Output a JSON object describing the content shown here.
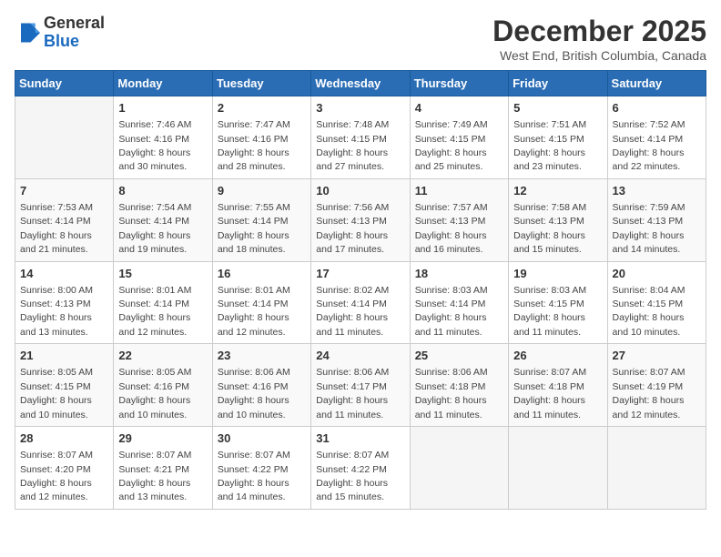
{
  "header": {
    "logo_general": "General",
    "logo_blue": "Blue",
    "month_title": "December 2025",
    "location": "West End, British Columbia, Canada"
  },
  "days_of_week": [
    "Sunday",
    "Monday",
    "Tuesday",
    "Wednesday",
    "Thursday",
    "Friday",
    "Saturday"
  ],
  "weeks": [
    [
      {
        "day": "",
        "info": ""
      },
      {
        "day": "1",
        "info": "Sunrise: 7:46 AM\nSunset: 4:16 PM\nDaylight: 8 hours\nand 30 minutes."
      },
      {
        "day": "2",
        "info": "Sunrise: 7:47 AM\nSunset: 4:16 PM\nDaylight: 8 hours\nand 28 minutes."
      },
      {
        "day": "3",
        "info": "Sunrise: 7:48 AM\nSunset: 4:15 PM\nDaylight: 8 hours\nand 27 minutes."
      },
      {
        "day": "4",
        "info": "Sunrise: 7:49 AM\nSunset: 4:15 PM\nDaylight: 8 hours\nand 25 minutes."
      },
      {
        "day": "5",
        "info": "Sunrise: 7:51 AM\nSunset: 4:15 PM\nDaylight: 8 hours\nand 23 minutes."
      },
      {
        "day": "6",
        "info": "Sunrise: 7:52 AM\nSunset: 4:14 PM\nDaylight: 8 hours\nand 22 minutes."
      }
    ],
    [
      {
        "day": "7",
        "info": "Sunrise: 7:53 AM\nSunset: 4:14 PM\nDaylight: 8 hours\nand 21 minutes."
      },
      {
        "day": "8",
        "info": "Sunrise: 7:54 AM\nSunset: 4:14 PM\nDaylight: 8 hours\nand 19 minutes."
      },
      {
        "day": "9",
        "info": "Sunrise: 7:55 AM\nSunset: 4:14 PM\nDaylight: 8 hours\nand 18 minutes."
      },
      {
        "day": "10",
        "info": "Sunrise: 7:56 AM\nSunset: 4:13 PM\nDaylight: 8 hours\nand 17 minutes."
      },
      {
        "day": "11",
        "info": "Sunrise: 7:57 AM\nSunset: 4:13 PM\nDaylight: 8 hours\nand 16 minutes."
      },
      {
        "day": "12",
        "info": "Sunrise: 7:58 AM\nSunset: 4:13 PM\nDaylight: 8 hours\nand 15 minutes."
      },
      {
        "day": "13",
        "info": "Sunrise: 7:59 AM\nSunset: 4:13 PM\nDaylight: 8 hours\nand 14 minutes."
      }
    ],
    [
      {
        "day": "14",
        "info": "Sunrise: 8:00 AM\nSunset: 4:13 PM\nDaylight: 8 hours\nand 13 minutes."
      },
      {
        "day": "15",
        "info": "Sunrise: 8:01 AM\nSunset: 4:14 PM\nDaylight: 8 hours\nand 12 minutes."
      },
      {
        "day": "16",
        "info": "Sunrise: 8:01 AM\nSunset: 4:14 PM\nDaylight: 8 hours\nand 12 minutes."
      },
      {
        "day": "17",
        "info": "Sunrise: 8:02 AM\nSunset: 4:14 PM\nDaylight: 8 hours\nand 11 minutes."
      },
      {
        "day": "18",
        "info": "Sunrise: 8:03 AM\nSunset: 4:14 PM\nDaylight: 8 hours\nand 11 minutes."
      },
      {
        "day": "19",
        "info": "Sunrise: 8:03 AM\nSunset: 4:15 PM\nDaylight: 8 hours\nand 11 minutes."
      },
      {
        "day": "20",
        "info": "Sunrise: 8:04 AM\nSunset: 4:15 PM\nDaylight: 8 hours\nand 10 minutes."
      }
    ],
    [
      {
        "day": "21",
        "info": "Sunrise: 8:05 AM\nSunset: 4:15 PM\nDaylight: 8 hours\nand 10 minutes."
      },
      {
        "day": "22",
        "info": "Sunrise: 8:05 AM\nSunset: 4:16 PM\nDaylight: 8 hours\nand 10 minutes."
      },
      {
        "day": "23",
        "info": "Sunrise: 8:06 AM\nSunset: 4:16 PM\nDaylight: 8 hours\nand 10 minutes."
      },
      {
        "day": "24",
        "info": "Sunrise: 8:06 AM\nSunset: 4:17 PM\nDaylight: 8 hours\nand 11 minutes."
      },
      {
        "day": "25",
        "info": "Sunrise: 8:06 AM\nSunset: 4:18 PM\nDaylight: 8 hours\nand 11 minutes."
      },
      {
        "day": "26",
        "info": "Sunrise: 8:07 AM\nSunset: 4:18 PM\nDaylight: 8 hours\nand 11 minutes."
      },
      {
        "day": "27",
        "info": "Sunrise: 8:07 AM\nSunset: 4:19 PM\nDaylight: 8 hours\nand 12 minutes."
      }
    ],
    [
      {
        "day": "28",
        "info": "Sunrise: 8:07 AM\nSunset: 4:20 PM\nDaylight: 8 hours\nand 12 minutes."
      },
      {
        "day": "29",
        "info": "Sunrise: 8:07 AM\nSunset: 4:21 PM\nDaylight: 8 hours\nand 13 minutes."
      },
      {
        "day": "30",
        "info": "Sunrise: 8:07 AM\nSunset: 4:22 PM\nDaylight: 8 hours\nand 14 minutes."
      },
      {
        "day": "31",
        "info": "Sunrise: 8:07 AM\nSunset: 4:22 PM\nDaylight: 8 hours\nand 15 minutes."
      },
      {
        "day": "",
        "info": ""
      },
      {
        "day": "",
        "info": ""
      },
      {
        "day": "",
        "info": ""
      }
    ]
  ]
}
